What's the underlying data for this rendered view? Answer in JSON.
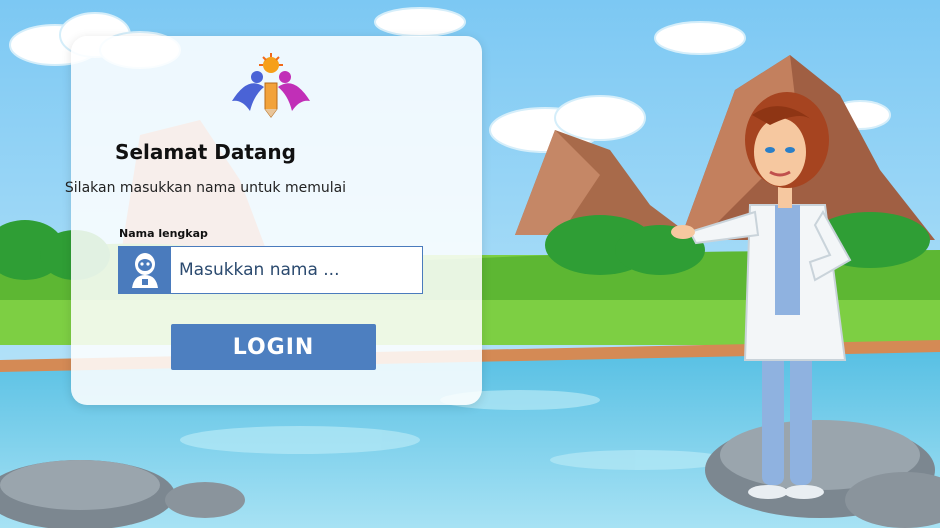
{
  "login_card": {
    "title": "Selamat Datang",
    "subtitle": "Silakan masukkan nama untuk memulai",
    "name_label": "Nama lengkap",
    "name_placeholder": "Masukkan nama ...",
    "login_button": "LOGIN"
  },
  "colors": {
    "accent": "#4d7fc0",
    "sky": "#9ed5f5",
    "grass": "#6cc63b",
    "water": "#7fd0ec"
  },
  "icons": {
    "logo": "kids-pencil-logo-icon",
    "user": "user-avatar-icon"
  }
}
